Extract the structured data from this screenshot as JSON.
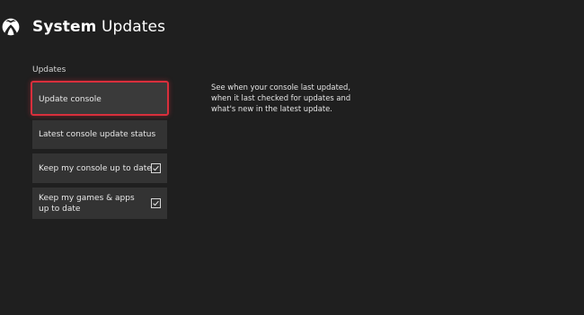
{
  "header": {
    "title_bold": "System",
    "title_rest": "Updates",
    "logo_icon": "xbox-logo-icon"
  },
  "section": {
    "label": "Updates"
  },
  "menu": {
    "items": [
      {
        "label": "Update console",
        "selected": true,
        "checkbox": false
      },
      {
        "label": "Latest console update status",
        "selected": false,
        "checkbox": false
      },
      {
        "label": "Keep my console up to date",
        "selected": false,
        "checkbox": true,
        "checked": true
      },
      {
        "label": "Keep my games & apps up to date",
        "selected": false,
        "checkbox": true,
        "checked": true
      }
    ]
  },
  "description": {
    "text": "See when your console last updated, when it last checked for updates and what's new in the latest update."
  },
  "colors": {
    "background": "#1f1f1f",
    "tile": "#333333",
    "focus_border": "#d92f3c",
    "text": "#ffffff"
  }
}
